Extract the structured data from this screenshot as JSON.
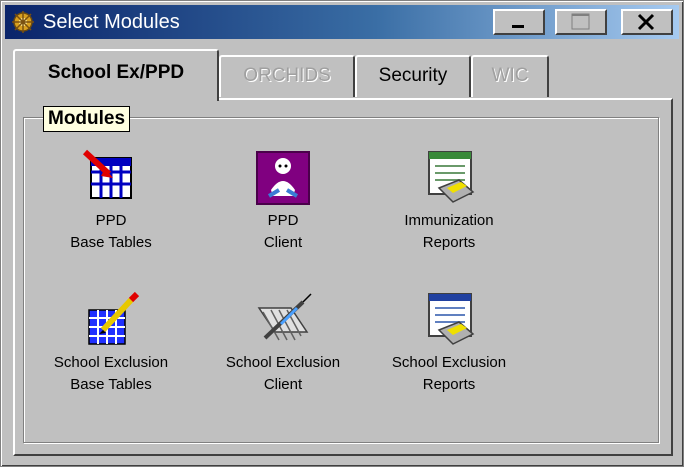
{
  "window": {
    "title": "Select Modules"
  },
  "titlebar_buttons": {
    "minimize": "minimize-icon",
    "maximize": "maximize-icon",
    "close": "close-icon"
  },
  "tabs": [
    {
      "label": "School Ex/PPD",
      "state": "active"
    },
    {
      "label": "ORCHIDS",
      "state": "disabled"
    },
    {
      "label": "Security",
      "state": "enabled"
    },
    {
      "label": "WIC",
      "state": "disabled"
    }
  ],
  "group": {
    "label": "Modules"
  },
  "modules": [
    {
      "line1": "PPD",
      "line2": "Base Tables",
      "icon": "table-edit-icon"
    },
    {
      "line1": "PPD",
      "line2": "Client",
      "icon": "baby-client-icon"
    },
    {
      "line1": "Immunization",
      "line2": "Reports",
      "icon": "report-printer-icon"
    },
    {
      "line1": "School Exclusion",
      "line2": "Base Tables",
      "icon": "grid-pencil-icon"
    },
    {
      "line1": "School Exclusion",
      "line2": "Client",
      "icon": "syringe-client-icon"
    },
    {
      "line1": "School Exclusion",
      "line2": "Reports",
      "icon": "report-printer-icon"
    }
  ],
  "colors": {
    "titlebar_start": "#0a246a",
    "titlebar_end": "#a6caf0",
    "tooltip_bg": "#ffffe1",
    "face": "#c0c0c0"
  }
}
